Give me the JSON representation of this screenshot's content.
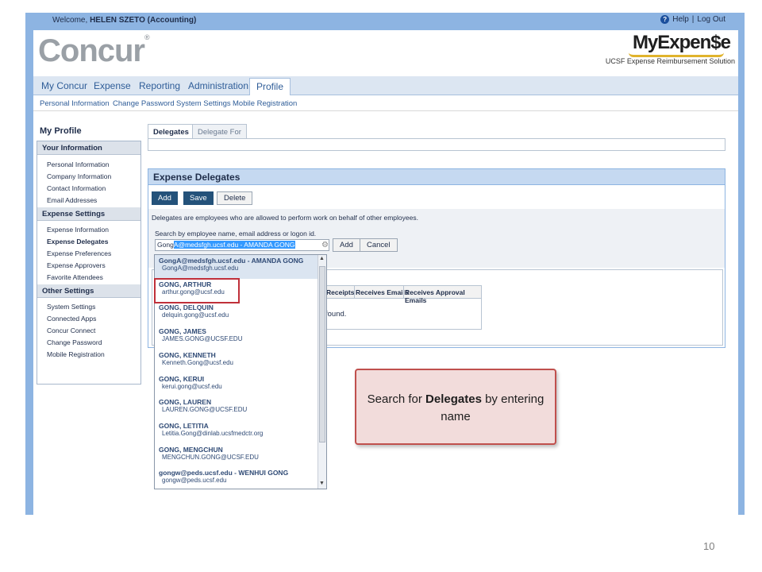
{
  "topbar": {
    "welcome_prefix": "Welcome, ",
    "user": "HELEN SZETO (Accounting)",
    "help": "Help",
    "separator": "|",
    "logout": "Log Out"
  },
  "header": {
    "logo": "Concur",
    "logo_mark": "®",
    "brand": "MyExpen$e",
    "tagline": "UCSF Expense Reimbursement Solution"
  },
  "nav": {
    "tabs": [
      {
        "label": "My Concur"
      },
      {
        "label": "Expense"
      },
      {
        "label": "Reporting"
      },
      {
        "label": "Administration"
      },
      {
        "label": "Profile"
      }
    ],
    "subnav": [
      "Personal Information",
      "Change Password",
      "System Settings",
      "Mobile Registration"
    ]
  },
  "sidebar": {
    "title": "My Profile",
    "sections": [
      {
        "heading": "Your Information",
        "items": [
          "Personal Information",
          "Company Information",
          "Contact Information",
          "Email Addresses"
        ]
      },
      {
        "heading": "Expense Settings",
        "items": [
          "Expense Information",
          "Expense Delegates",
          "Expense Preferences",
          "Expense Approvers",
          "Favorite Attendees"
        ]
      },
      {
        "heading": "Other Settings",
        "items": [
          "System Settings",
          "Connected Apps",
          "Concur Connect",
          "Change Password",
          "Mobile Registration"
        ]
      }
    ]
  },
  "content_tabs": [
    "Delegates",
    "Delegate For"
  ],
  "delegates": {
    "title": "Expense Delegates",
    "buttons": {
      "add": "Add",
      "save": "Save",
      "delete": "Delete"
    },
    "description": "Delegates are employees who are allowed to perform work on behalf of other employees.",
    "search_label": "Search by employee name, email address or logon id.",
    "search_typed": "Gong",
    "search_selected": "A@medsfgh.ucsf.edu - AMANDA GONG",
    "search_add": "Add",
    "search_cancel": "Cancel",
    "columns": [
      "Receipts",
      "Receives Emails",
      "Receives Approval Emails"
    ],
    "not_found": "found."
  },
  "dropdown": [
    {
      "name": "GongA@medsfgh.ucsf.edu - AMANDA GONG",
      "email": "GongA@medsfgh.ucsf.edu"
    },
    {
      "name": "GONG, ARTHUR",
      "email": "arthur.gong@ucsf.edu"
    },
    {
      "name": "GONG, DELQUIN",
      "email": "delquin.gong@ucsf.edu"
    },
    {
      "name": "GONG, JAMES",
      "email": "JAMES.GONG@UCSF.EDU"
    },
    {
      "name": "GONG, KENNETH",
      "email": "Kenneth.Gong@ucsf.edu"
    },
    {
      "name": "GONG, KERUI",
      "email": "kerui.gong@ucsf.edu"
    },
    {
      "name": "GONG, LAUREN",
      "email": "LAUREN.GONG@UCSF.EDU"
    },
    {
      "name": "GONG, LETITIA",
      "email": "Letitia.Gong@dinlab.ucsfmedctr.org"
    },
    {
      "name": "GONG, MENGCHUN",
      "email": "MENGCHUN.GONG@UCSF.EDU"
    },
    {
      "name": "gongw@peds.ucsf.edu - WENHUI GONG",
      "email": "gongw@peds.ucsf.edu"
    }
  ],
  "callout": {
    "pre": "Search for ",
    "bold": "Delegates",
    "post": " by entering name"
  },
  "page_number": "10",
  "colors": {
    "frame": "#8db4e2",
    "highlight": "#c0303a",
    "callout_bg": "#f2dcdb",
    "callout_border": "#c0504d"
  }
}
